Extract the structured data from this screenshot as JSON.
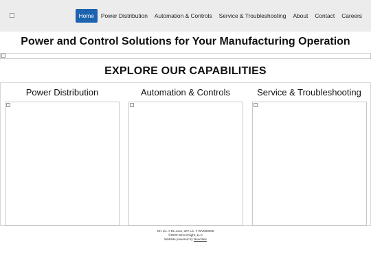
{
  "header": {
    "logo_icon": "broken-image-icon",
    "nav": [
      {
        "label": "Home",
        "active": true
      },
      {
        "label": "Power Distribution",
        "active": false
      },
      {
        "label": "Automation & Controls",
        "active": false
      },
      {
        "label": "Service & Troubleshooting",
        "active": false
      },
      {
        "label": "About",
        "active": false
      },
      {
        "label": "Contact",
        "active": false
      },
      {
        "label": "Careers",
        "active": false
      }
    ]
  },
  "hero": {
    "title": "Power and Control Solutions for Your Manufacturing Operation"
  },
  "capabilities": {
    "title": "EXPLORE OUR CAPABILITIES",
    "cards": [
      {
        "title": "Power Distribution"
      },
      {
        "title": "Automation & Controls"
      },
      {
        "title": "Service & Troubleshooting"
      }
    ]
  },
  "footer": {
    "license": "OH Lic. # EL.xxxx, WV Lic. # WV060006",
    "copyright": "©2020 Wrenchlight, LLC",
    "powered_prefix": "Website powered by",
    "powered_link": "Neocities"
  },
  "colors": {
    "header_bg": "#ececec",
    "accent": "#1c63b0"
  }
}
